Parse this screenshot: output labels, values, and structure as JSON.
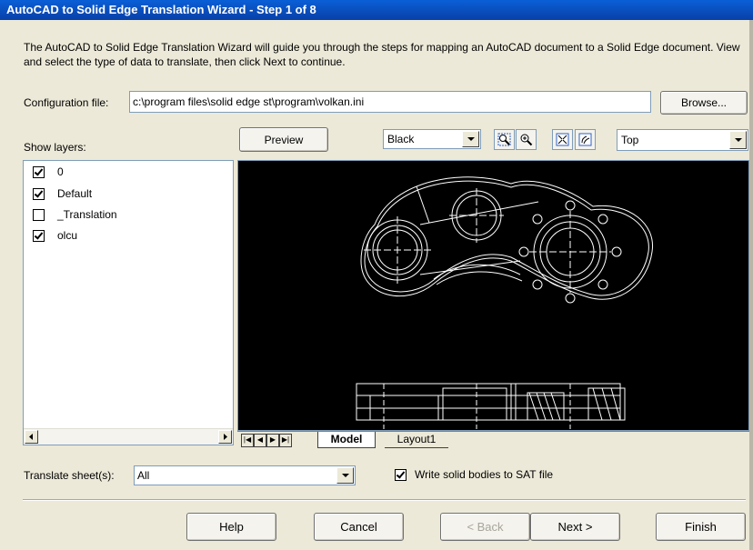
{
  "window": {
    "title": "AutoCAD to Solid Edge Translation Wizard - Step 1 of 8"
  },
  "intro": {
    "text": "The AutoCAD to Solid Edge Translation  Wizard will guide you through the steps for mapping an AutoCAD document to a Solid Edge document.  View and select the type of data to translate, then click Next to continue."
  },
  "config": {
    "label": "Configuration file:",
    "value": "c:\\program files\\solid edge st\\program\\volkan.ini",
    "browse": "Browse..."
  },
  "layers": {
    "label": "Show layers:",
    "items": [
      {
        "name": "0",
        "checked": true
      },
      {
        "name": "Default",
        "checked": true
      },
      {
        "name": "_Translation",
        "checked": false
      },
      {
        "name": "olcu",
        "checked": true
      }
    ]
  },
  "toolbar": {
    "preview_label": "Preview",
    "background_value": "Black",
    "view_value": "Top",
    "icons": [
      "zoom-area-icon",
      "zoom-icon",
      "fit-icon",
      "pan-icon"
    ]
  },
  "tabs": {
    "model": "Model",
    "layout1": "Layout1"
  },
  "translate": {
    "label": "Translate sheet(s):",
    "value": "All"
  },
  "sat": {
    "label": "Write solid bodies to SAT file",
    "checked": true
  },
  "buttons": {
    "help": "Help",
    "cancel": "Cancel",
    "back": "< Back",
    "next": "Next >",
    "finish": "Finish"
  }
}
